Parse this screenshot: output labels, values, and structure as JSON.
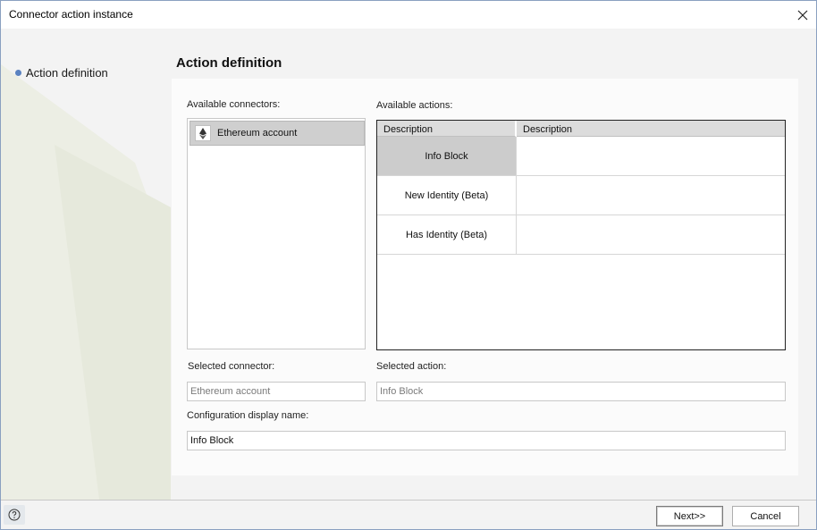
{
  "window": {
    "title": "Connector action instance"
  },
  "nav": {
    "items": [
      {
        "label": "Action definition",
        "icon": "bullet-icon"
      }
    ]
  },
  "main": {
    "heading": "Action definition",
    "connectors": {
      "label": "Available connectors:",
      "items": [
        {
          "label": "Ethereum account",
          "icon": "ethereum-icon",
          "selected": true
        }
      ]
    },
    "actions": {
      "label": "Available actions:",
      "columns": [
        "Description",
        "Description"
      ],
      "rows": [
        {
          "name": "Info Block",
          "description": "",
          "selected": true
        },
        {
          "name": "New Identity (Beta)",
          "description": ""
        },
        {
          "name": "Has Identity (Beta)",
          "description": ""
        }
      ]
    },
    "selected_connector": {
      "label": "Selected connector:",
      "value": "Ethereum account"
    },
    "selected_action": {
      "label": "Selected action:",
      "value": "Info Block"
    },
    "config_name": {
      "label": "Configuration display name:",
      "value": "Info Block"
    }
  },
  "footer": {
    "help_icon": "help-icon",
    "next_label": "Next>>",
    "cancel_label": "Cancel"
  },
  "colors": {
    "accent": "#5a82c0",
    "selection": "#cccccc",
    "window_border": "#8aa0c0"
  }
}
